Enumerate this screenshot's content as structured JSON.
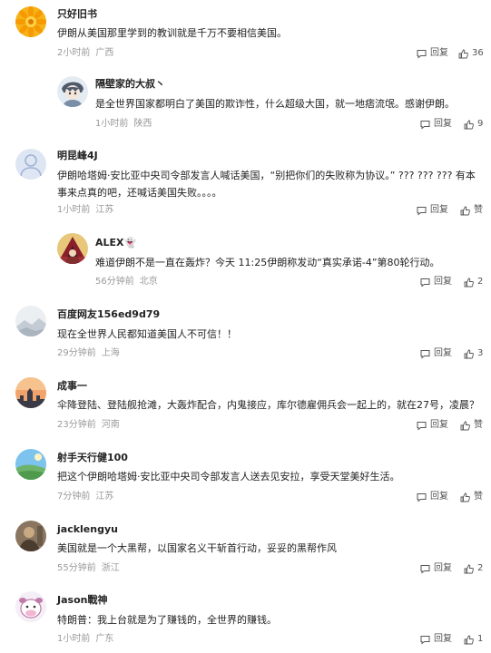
{
  "actions": {
    "reply_label": "回复"
  },
  "comments": [
    {
      "id": "c1",
      "username": "只好旧书",
      "text": "伊朗从美国那里学到的教训就是千万不要相信美国。",
      "time": "2小时前",
      "location": "广西",
      "likes": "36",
      "avatar_icon": "orange-flower-avatar",
      "avatar_colors": [
        "#f5a200",
        "#ffd24a"
      ]
    },
    {
      "id": "c1r1",
      "username": "隔壁家的大叔丶",
      "text": "是全世界国家都明白了美国的欺诈性，什么超级大国，就一地痞流氓。感谢伊朗。",
      "time": "1小时前",
      "location": "陕西",
      "likes": "9",
      "avatar_icon": "anime-character-avatar",
      "avatar_colors": [
        "#dfe8f0",
        "#7a8fa6"
      ]
    },
    {
      "id": "c2",
      "username": "明昆峰4J",
      "text": "伊朗哈塔姆·安比亚中央司令部发言人喊话美国，“别把你们的失败称为协议。” ??? ??? ??? 有本事来点真的吧，还喊话美国失败。。。。",
      "time": "1小时前",
      "location": "江苏",
      "likes": "赞",
      "avatar_icon": "default-user-avatar",
      "avatar_colors": [
        "#dce4f2",
        "#9fb2d6"
      ]
    },
    {
      "id": "c2r1",
      "username": "ALEX👻",
      "text": "难道伊朗不是一直在轰炸？今天 11:25伊朗称发动“真实承诺-4”第80轮行动。",
      "time": "56分钟前",
      "location": "北京",
      "likes": "2",
      "avatar_icon": "hooded-figure-avatar",
      "avatar_colors": [
        "#8a1f2b",
        "#e0b04a"
      ]
    },
    {
      "id": "c3",
      "username": "百度网友156ed9d79",
      "text": "现在全世界人民都知道美国人不可信！！",
      "time": "29分钟前",
      "location": "上海",
      "likes": "3",
      "avatar_icon": "mountain-sky-avatar",
      "avatar_colors": [
        "#c9d3dc",
        "#eceff2"
      ]
    },
    {
      "id": "c4",
      "username": "成事一",
      "text": "伞降登陆、登陆舰抢滩，大轰炸配合，内鬼接应，库尔德雇佣兵会一起上的，就在27号，凌晨？",
      "time": "23分钟前",
      "location": "河南",
      "likes": "赞",
      "avatar_icon": "sunset-city-avatar",
      "avatar_colors": [
        "#f2a36b",
        "#3a3b46"
      ]
    },
    {
      "id": "c5",
      "username": "射手天行健100",
      "text": "把这个伊朗哈塔姆·安比亚中央司令部发言人送去见安拉，享受天堂美好生活。",
      "time": "7分钟前",
      "location": "江苏",
      "likes": "赞",
      "avatar_icon": "landscape-avatar",
      "avatar_colors": [
        "#6fb8e8",
        "#6db36a"
      ]
    },
    {
      "id": "c6",
      "username": "jacklengyu",
      "text": "美国就是一个大黑帮，以国家名义干斩首行动，妥妥的黑帮作风",
      "time": "55分钟前",
      "location": "浙江",
      "likes": "2",
      "avatar_icon": "sepia-photo-avatar",
      "avatar_colors": [
        "#8a7660",
        "#4a3d30"
      ]
    },
    {
      "id": "c7",
      "username": "Jason戰神",
      "text": "特朗普：我上台就是为了赚钱的，全世界的赚钱。",
      "time": "1小时前",
      "location": "广东",
      "likes": "1",
      "avatar_icon": "cartoon-cow-avatar",
      "avatar_colors": [
        "#ffffff",
        "#c07aa8"
      ]
    }
  ]
}
